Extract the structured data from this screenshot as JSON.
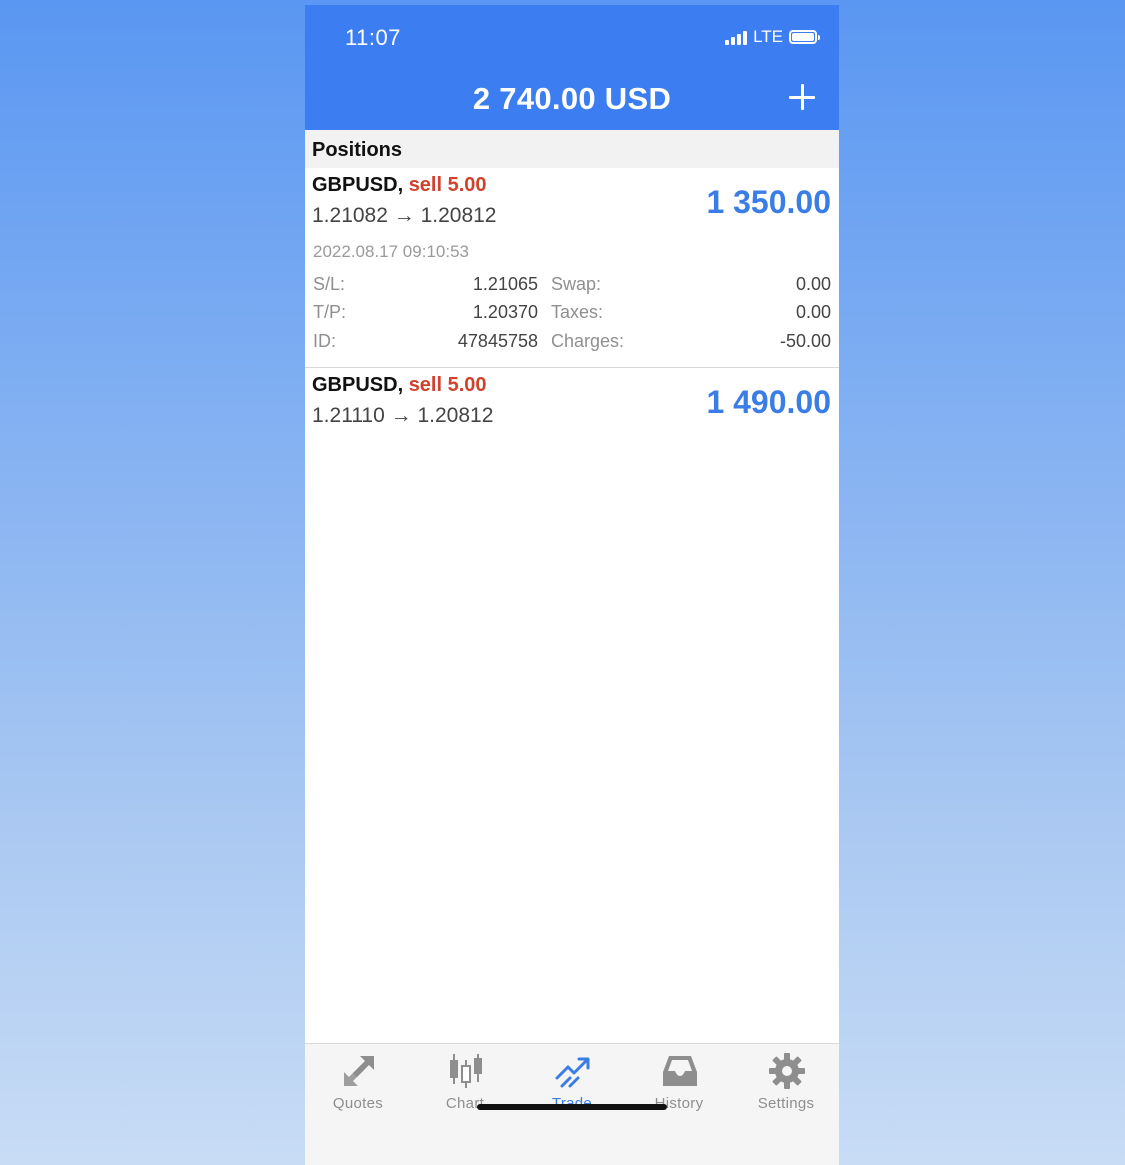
{
  "status": {
    "time": "11:07",
    "network": "LTE"
  },
  "header": {
    "balance": "2 740.00 USD"
  },
  "section": {
    "title": "Positions"
  },
  "positions": [
    {
      "symbol": "GBPUSD,",
      "side": "sell 5.00",
      "prices": "1.21082 → 1.20812",
      "profit": "1 350.00",
      "time": "2022.08.17 09:10:53",
      "sl_label": "S/L:",
      "sl": "1.21065",
      "tp_label": "T/P:",
      "tp": "1.20370",
      "id_label": "ID:",
      "id": "47845758",
      "swap_label": "Swap:",
      "swap": "0.00",
      "taxes_label": "Taxes:",
      "taxes": "0.00",
      "charges_label": "Charges:",
      "charges": "-50.00"
    },
    {
      "symbol": "GBPUSD,",
      "side": "sell 5.00",
      "prices": "1.21110 → 1.20812",
      "profit": "1 490.00"
    }
  ],
  "tabs": [
    {
      "label": "Quotes",
      "icon": "quotes-icon"
    },
    {
      "label": "Chart",
      "icon": "candlestick-icon"
    },
    {
      "label": "Trade",
      "icon": "trade-icon",
      "active": true
    },
    {
      "label": "History",
      "icon": "inbox-icon"
    },
    {
      "label": "Settings",
      "icon": "gear-icon"
    }
  ],
  "colors": {
    "accent": "#3c7ef2",
    "sell": "#d0412e",
    "profit": "#3b7de6",
    "inactive": "#8e8e8e"
  }
}
